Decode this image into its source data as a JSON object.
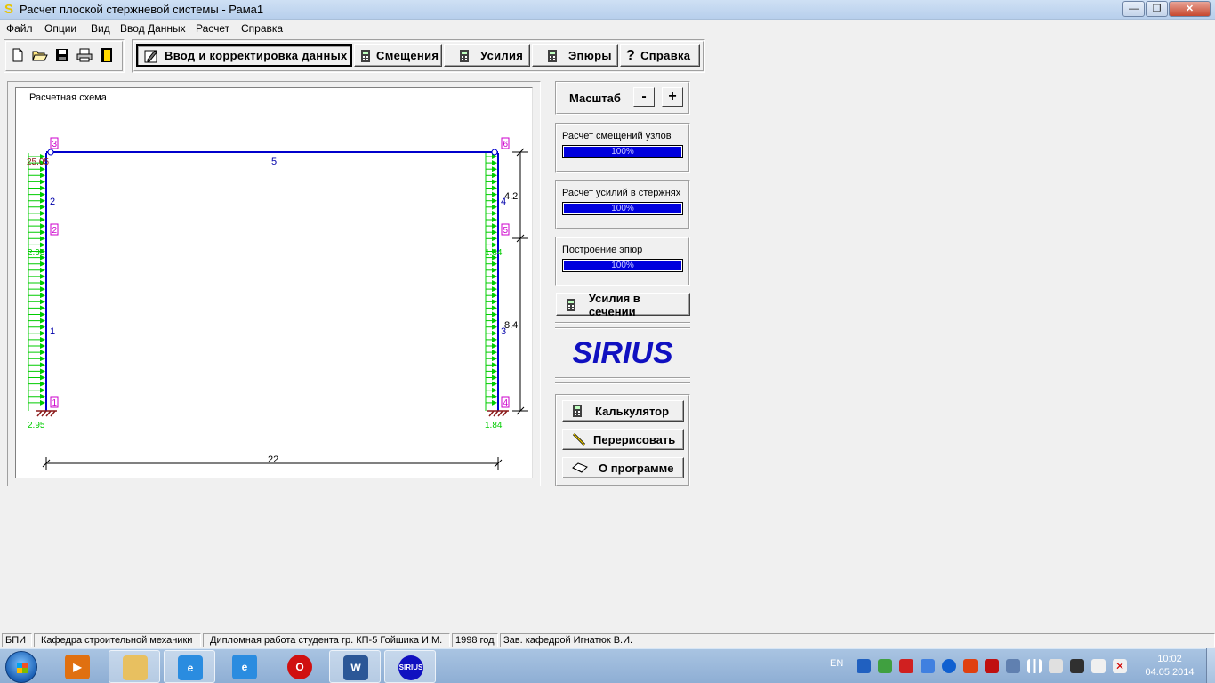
{
  "window": {
    "title": "Расчет плоской стержневой системы - Рама1",
    "minimize": "—",
    "maximize": "❐",
    "close": "✕"
  },
  "menu": [
    "Файл",
    "Опции",
    "Вид",
    "Ввод Данных",
    "Расчет",
    "Справка"
  ],
  "toolbar": {
    "file_icons": [
      "new-file-icon",
      "open-folder-icon",
      "save-icon",
      "print-icon",
      "exit-door-icon"
    ],
    "tabs": [
      {
        "label": "Ввод и корректировка данных",
        "icon": "edit-data-icon",
        "pressed": true
      },
      {
        "label": "Смещения",
        "icon": "calculator-icon",
        "pressed": false
      },
      {
        "label": "Усилия",
        "icon": "calculator-icon",
        "pressed": false
      },
      {
        "label": "Эпюры",
        "icon": "calculator-icon",
        "pressed": false
      },
      {
        "label": "Справка",
        "icon": "help-icon",
        "pressed": false
      }
    ]
  },
  "scheme": {
    "title": "Расчетная схема",
    "node_labels": [
      "1",
      "2",
      "3",
      "4",
      "5",
      "6"
    ],
    "member_labels": [
      "1",
      "2",
      "3",
      "4",
      "5"
    ],
    "load_labels": {
      "top_left": "25.05",
      "mid_left": "2.95",
      "bottom_left": "2.95",
      "mid_right": "1.84",
      "bottom_right": "1.84"
    },
    "dimensions": {
      "width": "22",
      "upper": "4.2",
      "lower": "8.4"
    },
    "colors": {
      "frame": "#0000cc",
      "nodes": "#cc00cc",
      "load": "#00cc00",
      "support": "#8b1a1a"
    }
  },
  "panel": {
    "scale_label": "Масштаб",
    "zoom_out": "-",
    "zoom_in": "+",
    "progress": [
      {
        "label": "Расчет смещений узлов",
        "value": 1.0,
        "text": "100%"
      },
      {
        "label": "Расчет усилий в стержнях",
        "value": 1.0,
        "text": "100%"
      },
      {
        "label": "Построение эпюр",
        "value": 1.0,
        "text": "100%"
      }
    ],
    "section_forces": "Усилия в сечении",
    "logo": "SIRIUS",
    "calculator": "Калькулятор",
    "redraw": "Перерисовать",
    "about": "О программе"
  },
  "status": [
    "БПИ",
    "Кафедра строительной механики",
    "Дипломная работа студента гр. КП-5 Гойшика И.М.",
    "1998 год",
    "Зав. кафедрой Игнатюк В.И."
  ],
  "taskbar": {
    "apps": [
      "media-player-icon",
      "file-explorer-icon",
      "internet-explorer-icon",
      "internet-explorer-icon",
      "opera-icon",
      "word-icon",
      "sirius-icon"
    ],
    "lang": "EN",
    "time": "10:02",
    "date": "04.05.2014"
  }
}
